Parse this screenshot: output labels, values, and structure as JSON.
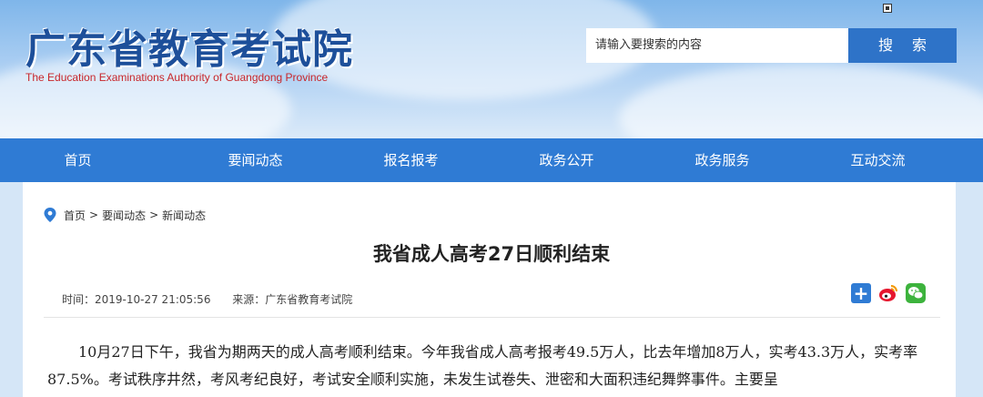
{
  "header": {
    "title": "广东省教育考试院",
    "subtitle": "The Education Examinations Authority of Guangdong Province"
  },
  "search": {
    "placeholder": "请输入要搜索的内容",
    "button_label": "搜 索"
  },
  "nav": {
    "items": [
      "首页",
      "要闻动态",
      "报名报考",
      "政务公开",
      "政务服务",
      "互动交流"
    ]
  },
  "breadcrumb": {
    "items": [
      "首页",
      "要闻动态",
      "新闻动态"
    ],
    "separator": ">"
  },
  "article": {
    "title": "我省成人高考27日顺利结束",
    "time": "时间：2019-10-27 21:05:56",
    "source": "来源：广东省教育考试院",
    "body": "10月27日下午，我省为期两天的成人高考顺利结束。今年我省成人高考报考49.5万人，比去年增加8万人，实考43.3万人，实考率87.5%。考试秩序井然，考风考纪良好，考试安全顺利实施，未发生试卷失、泄密和大面积违纪舞弊事件。主要呈"
  },
  "share": {
    "icons": [
      "plus-share-icon",
      "weibo-icon",
      "wechat-icon"
    ]
  },
  "colors": {
    "nav_bg": "#2f7bd4",
    "search_button": "#2e73c8",
    "title_blue": "#1d4f9a",
    "subtitle_red": "#c8262a"
  }
}
